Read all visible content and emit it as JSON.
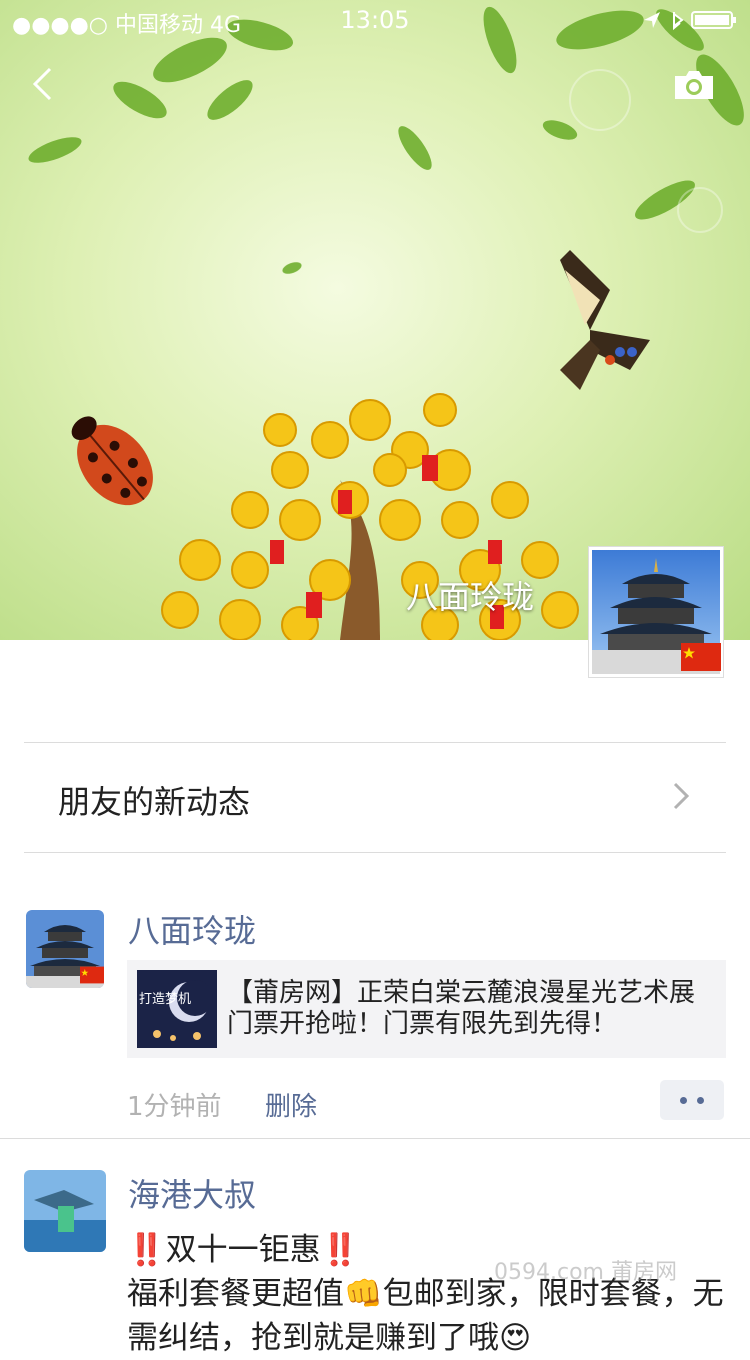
{
  "status_bar": {
    "signal_dots": "●●●●○",
    "carrier": "中国移动",
    "network": "4G",
    "time": "13:05",
    "location_icon": "location-arrow-icon",
    "bluetooth_icon": "bluetooth-icon",
    "battery_icon": "battery-icon"
  },
  "header": {
    "back_icon": "chevron-left-icon",
    "camera_icon": "camera-icon",
    "nickname": "八面玲珑"
  },
  "friends_updates": {
    "label": "朋友的新动态",
    "chevron_icon": "chevron-right-icon"
  },
  "posts": [
    {
      "author": "八面玲珑",
      "share_thumb_text": "打造梦机",
      "share_title": "【莆房网】正荣白棠云麓浪漫星光艺术展门票开抢啦！门票有限先到先得！",
      "time": "1分钟前",
      "delete_label": "删除",
      "more_icon": "more-dots-icon"
    },
    {
      "author": "海港大叔",
      "text": "‼️双十一钜惠‼️\n福利套餐更超值👊包邮到家，限时套餐，无需纠结，抢到就是赚到了哦😍"
    }
  ],
  "watermark": "0594.com 莆房网",
  "colors": {
    "link_blue": "#576b95",
    "meta_gray": "#b2b2b2",
    "card_bg": "#f3f3f5"
  }
}
